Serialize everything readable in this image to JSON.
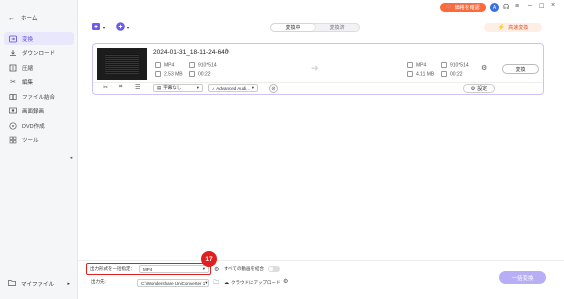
{
  "sidebar": {
    "home_label": "ホーム",
    "items": [
      {
        "label": "変換",
        "icon": "convert-icon"
      },
      {
        "label": "ダウンロード",
        "icon": "download-icon"
      },
      {
        "label": "圧縮",
        "icon": "compress-icon"
      },
      {
        "label": "編集",
        "icon": "scissors-icon"
      },
      {
        "label": "ファイル結合",
        "icon": "merge-icon"
      },
      {
        "label": "画面録画",
        "icon": "screen-record-icon"
      },
      {
        "label": "DVD作成",
        "icon": "dvd-icon"
      },
      {
        "label": "ツール",
        "icon": "grid-icon"
      }
    ],
    "my_files_label": "マイファイル"
  },
  "topbar": {
    "buy_label": "価格を確認",
    "avatar_letter": "A",
    "tabs": [
      {
        "label": "変換中",
        "active": true
      },
      {
        "label": "変換済",
        "active": false
      }
    ],
    "speed_label": "高速変換"
  },
  "file": {
    "name": "2024-01-31_18-11-24-640",
    "source": {
      "format": "MP4",
      "resolution": "910*514",
      "size": "2.53 MB",
      "duration": "00:22"
    },
    "target": {
      "format": "MP4",
      "resolution": "910*514",
      "size": "4.11 MB",
      "duration": "00:22"
    },
    "subtitle_value": "字幕なし",
    "audio_value": "Advanced Audi...",
    "settings_label": "設定",
    "convert_label": "変換"
  },
  "bottom": {
    "output_format_label": "出力形式を一括指定：",
    "output_format_value": "MP4",
    "merge_label": "すべての動画を結合",
    "output_dir_label": "出力先:",
    "output_dir_value": "C:\\Wondershare UniConverter 1",
    "cloud_upload_label": "クラウドにアップロード",
    "batch_convert_label": "一括変換",
    "step_badge": "17"
  },
  "colors": {
    "accent": "#6c5ce7",
    "highlight_red": "#e02020",
    "badge_orange": "#ff6a3d"
  }
}
